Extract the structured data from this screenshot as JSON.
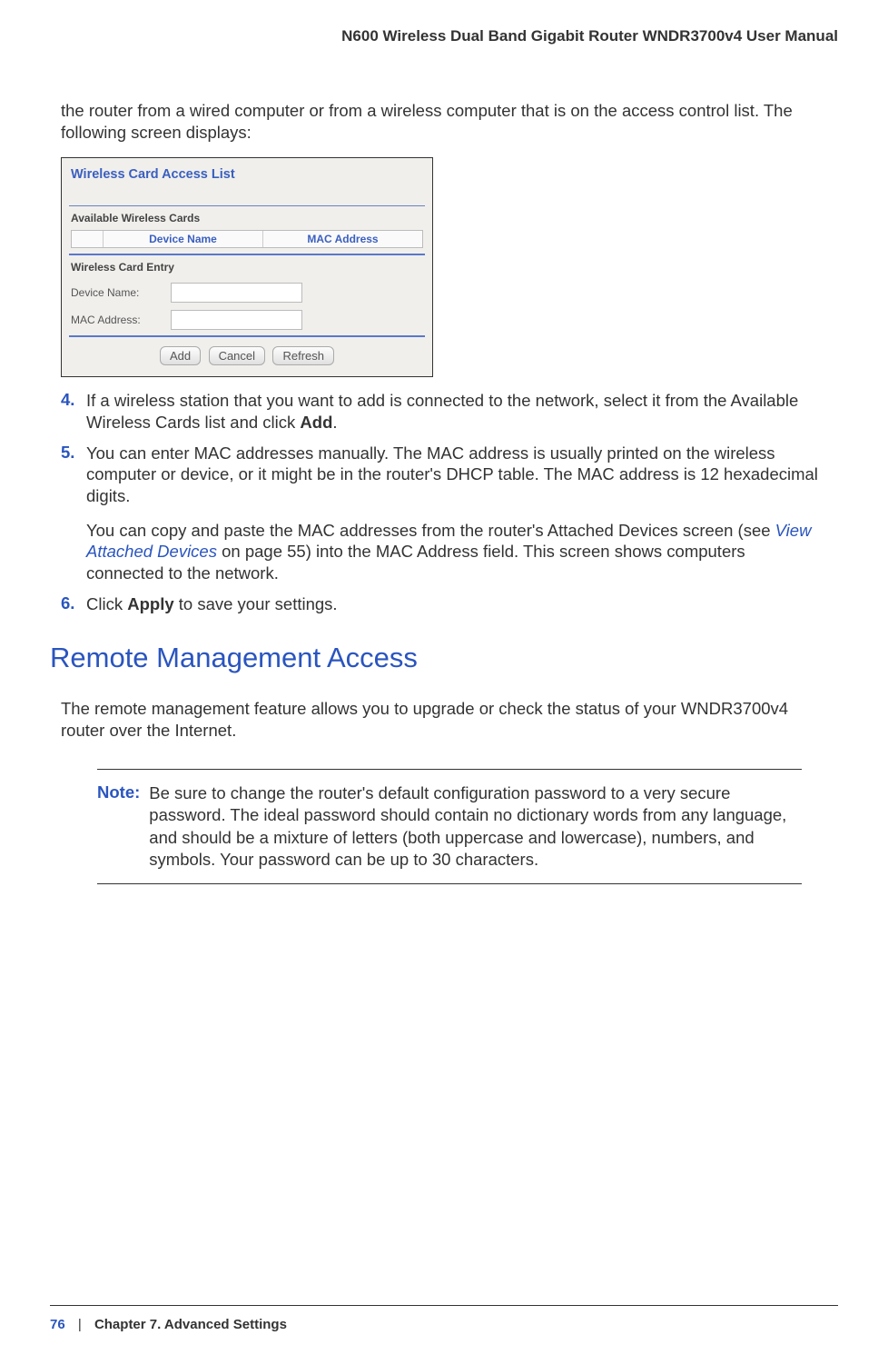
{
  "header": {
    "title": "N600 Wireless Dual Band Gigabit Router WNDR3700v4 User Manual"
  },
  "intro": "the router from a wired computer or from a wireless computer that is on the access control list. The following screen displays:",
  "screenshot": {
    "title": "Wireless Card Access List",
    "available_header": "Available Wireless Cards",
    "table_headers": {
      "device": "Device Name",
      "mac": "MAC Address"
    },
    "entry_header": "Wireless Card Entry",
    "device_name_label": "Device Name:",
    "mac_address_label": "MAC Address:",
    "add_btn": "Add",
    "cancel_btn": "Cancel",
    "refresh_btn": "Refresh"
  },
  "steps": {
    "s4_num": "4.",
    "s4_a": "If a wireless station that you want to add is connected to the network, select it from the Available Wireless Cards list and click ",
    "s4_bold": "Add",
    "s4_b": ".",
    "s5_num": "5.",
    "s5": "You can enter MAC addresses manually. The MAC address is usually printed on the wireless computer or device, or it might be in the router's DHCP table. The MAC address is 12 hexadecimal digits.",
    "s5_sub_a": "You can copy and paste the MAC addresses from the router's Attached Devices screen (see ",
    "s5_sub_link": "View Attached Devices",
    "s5_sub_b": " on page 55) into the MAC Address field. This screen shows computers connected to the network.",
    "s6_num": "6.",
    "s6_a": "Click ",
    "s6_bold": "Apply",
    "s6_b": " to save your settings."
  },
  "section": {
    "heading": "Remote Management Access",
    "body": "The remote management feature allows you to upgrade or check the status of your WNDR3700v4 router over the Internet."
  },
  "note": {
    "label": "Note:",
    "text": "Be sure to change the router's default configuration password to a very secure password. The ideal password should contain no dictionary words from any language, and should be a mixture of letters (both uppercase and lowercase), numbers, and symbols. Your password can be up to 30 characters."
  },
  "footer": {
    "page": "76",
    "sep": "|",
    "chapter": "Chapter 7.  Advanced Settings"
  }
}
